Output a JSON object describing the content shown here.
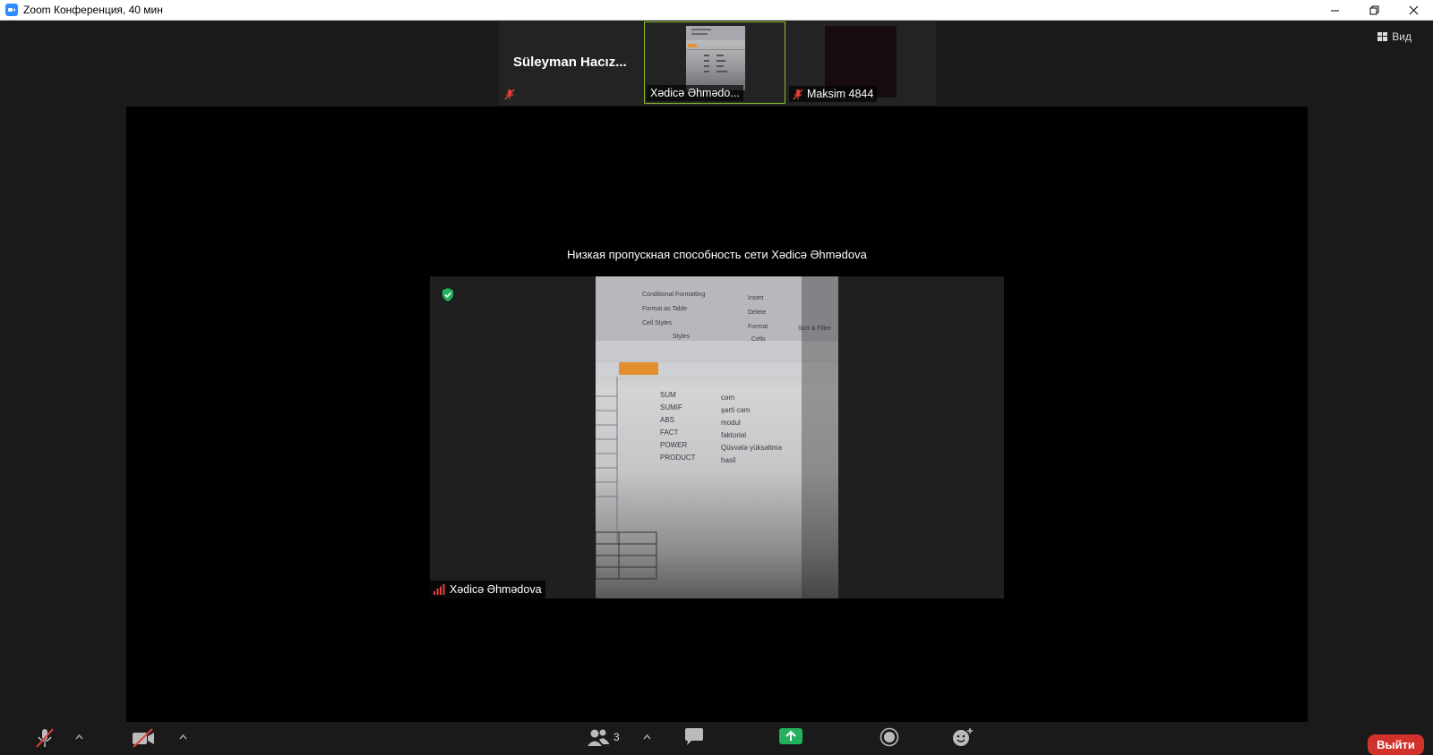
{
  "window": {
    "title": "Zoom Конференция, 40 мин",
    "app_icon": "zoom-icon",
    "controls": [
      "minimize-icon",
      "restore-icon",
      "close-icon"
    ]
  },
  "view_button": {
    "label": "Вид",
    "icon": "grid-icon"
  },
  "thumbnails": [
    {
      "name": "Süleyman  Hacız...",
      "mic_muted": true,
      "video": "off",
      "active": false
    },
    {
      "name": "Xədicə Əhmədo...",
      "mic_muted": false,
      "video": "on",
      "active": true
    },
    {
      "name": "Maksim 4844",
      "mic_muted": true,
      "video": "dark",
      "active": false
    }
  ],
  "main": {
    "bandwidth_message": "Низкая пропускная способность сети Xədicə Əhmədova",
    "speaker_name": "Xədicə Əhmədova",
    "encryption_icon": "shield-check-icon",
    "signal_icon": "signal-bars-icon",
    "shared_content_text": [
      "SUM",
      "SUMIF",
      "ABS",
      "FACT",
      "POWER",
      "PRODUCT",
      "cəm",
      "şərti cəm",
      "modul",
      "faktorial",
      "Qüvvətə yüksəltmə",
      "hasil",
      "Conditional Formatting",
      "Format as Table",
      "Cell Styles",
      "Styles",
      "Insert",
      "Delete",
      "Format",
      "Cells",
      "Sort & Filter"
    ]
  },
  "toolbar": {
    "participants_count": "3",
    "leave_label": "Выйти",
    "icons": [
      "mic-muted-icon",
      "video-off-icon",
      "participants-icon",
      "chat-icon",
      "share-screen-icon",
      "record-icon",
      "reactions-icon"
    ]
  },
  "colors": {
    "active_border": "#8fbe2f",
    "leave_button": "#d2322c",
    "muted_red": "#e0403a",
    "share_green": "#23b15b",
    "zoom_blue": "#2d8cff"
  }
}
